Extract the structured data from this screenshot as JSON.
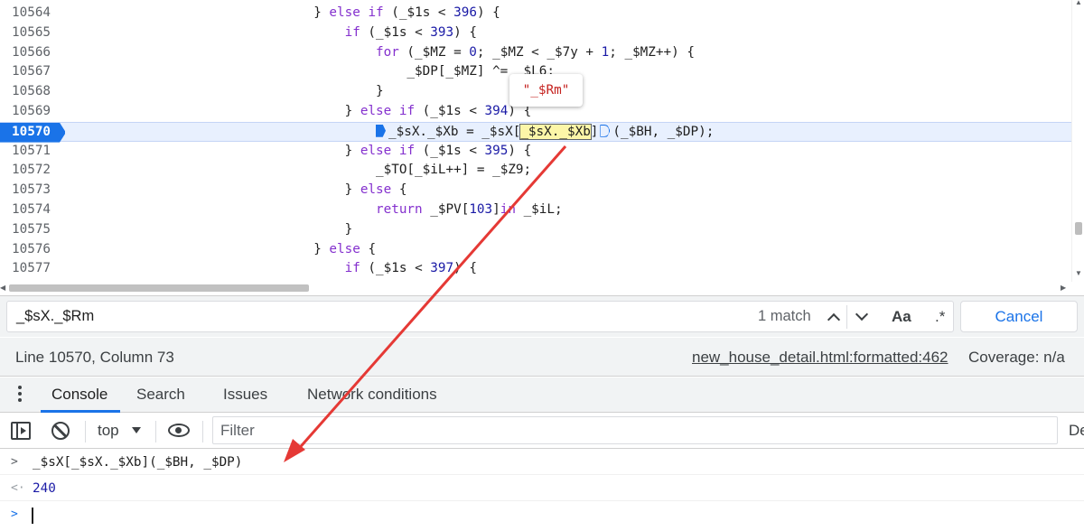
{
  "editor": {
    "lines": [
      {
        "num": "10564",
        "indent": 32,
        "tokens": [
          [
            "p",
            "} "
          ],
          [
            "kw",
            "else if"
          ],
          [
            "p",
            " (_$1s < "
          ],
          [
            "num",
            "396"
          ],
          [
            "p",
            ") {"
          ]
        ]
      },
      {
        "num": "10565",
        "indent": 36,
        "tokens": [
          [
            "kw",
            "if"
          ],
          [
            "p",
            " (_$1s < "
          ],
          [
            "num",
            "393"
          ],
          [
            "p",
            ") {"
          ]
        ]
      },
      {
        "num": "10566",
        "indent": 40,
        "tokens": [
          [
            "kw",
            "for"
          ],
          [
            "p",
            " (_$MZ = "
          ],
          [
            "num",
            "0"
          ],
          [
            "p",
            "; _$MZ < _$7y + "
          ],
          [
            "num",
            "1"
          ],
          [
            "p",
            "; _$MZ++) {"
          ]
        ]
      },
      {
        "num": "10567",
        "indent": 44,
        "tokens": [
          [
            "p",
            "_$DP[_$MZ] ^= _$L6;"
          ]
        ]
      },
      {
        "num": "10568",
        "indent": 40,
        "tokens": [
          [
            "p",
            "}"
          ]
        ]
      },
      {
        "num": "10569",
        "indent": 36,
        "tokens": [
          [
            "p",
            "} "
          ],
          [
            "kw",
            "else if"
          ],
          [
            "p",
            " (_$1s < "
          ],
          [
            "num",
            "394"
          ],
          [
            "p",
            ") {"
          ]
        ]
      },
      {
        "num": "10570",
        "indent": 40,
        "highlight": true,
        "tokens": [
          [
            "bp",
            ""
          ],
          [
            "p",
            "_$sX._$Xb = _$sX["
          ],
          [
            "match",
            "_$sX._$Xb"
          ],
          [
            "p",
            "]"
          ],
          [
            "bpe",
            ""
          ],
          [
            "p",
            "(_$BH, _$DP);"
          ]
        ]
      },
      {
        "num": "10571",
        "indent": 36,
        "tokens": [
          [
            "p",
            "} "
          ],
          [
            "kw",
            "else if"
          ],
          [
            "p",
            " (_$1s < "
          ],
          [
            "num",
            "395"
          ],
          [
            "p",
            ") {"
          ]
        ]
      },
      {
        "num": "10572",
        "indent": 40,
        "tokens": [
          [
            "p",
            "_$TO[_$iL++] = _$Z9;"
          ]
        ]
      },
      {
        "num": "10573",
        "indent": 36,
        "tokens": [
          [
            "p",
            "} "
          ],
          [
            "kw",
            "else"
          ],
          [
            "p",
            " {"
          ]
        ]
      },
      {
        "num": "10574",
        "indent": 40,
        "tokens": [
          [
            "kw",
            "return"
          ],
          [
            "p",
            " _$PV["
          ],
          [
            "num",
            "103"
          ],
          [
            "p",
            "]"
          ],
          [
            "kw",
            "in"
          ],
          [
            "p",
            " _$iL;"
          ]
        ]
      },
      {
        "num": "10575",
        "indent": 36,
        "tokens": [
          [
            "p",
            "}"
          ]
        ]
      },
      {
        "num": "10576",
        "indent": 32,
        "tokens": [
          [
            "p",
            "} "
          ],
          [
            "kw",
            "else"
          ],
          [
            "p",
            " {"
          ]
        ]
      },
      {
        "num": "10577",
        "indent": 36,
        "tokens": [
          [
            "kw",
            "if"
          ],
          [
            "p",
            " (_$1s < "
          ],
          [
            "num",
            "397"
          ],
          [
            "p",
            ") {"
          ]
        ]
      }
    ],
    "tooltip": "\"_$Rm\""
  },
  "search": {
    "value": "_$sX._$Rm",
    "match_count": "1 match",
    "case_label": "Aa",
    "regex_label": ".*",
    "cancel_label": "Cancel"
  },
  "status": {
    "cursor": "Line 10570, Column 73",
    "source": "new_house_detail.html:formatted:462",
    "coverage": "Coverage: n/a"
  },
  "drawer": {
    "tabs": [
      {
        "label": "Console",
        "active": true
      },
      {
        "label": "Search"
      },
      {
        "label": "Issues"
      },
      {
        "label": "Network conditions"
      }
    ]
  },
  "console_toolbar": {
    "context": "top",
    "filter_placeholder": "Filter",
    "levels_label": "De"
  },
  "console": {
    "input_prefix": ">",
    "result_prefix": "<·",
    "prompt_prefix": ">",
    "input": "_$sX[_$sX._$Xb](_$BH, _$DP)",
    "result": "240"
  },
  "colors": {
    "accent": "#1a73e8",
    "annotation_arrow": "#e53935",
    "keyword": "#8430ce",
    "number": "#1a1aa6"
  }
}
